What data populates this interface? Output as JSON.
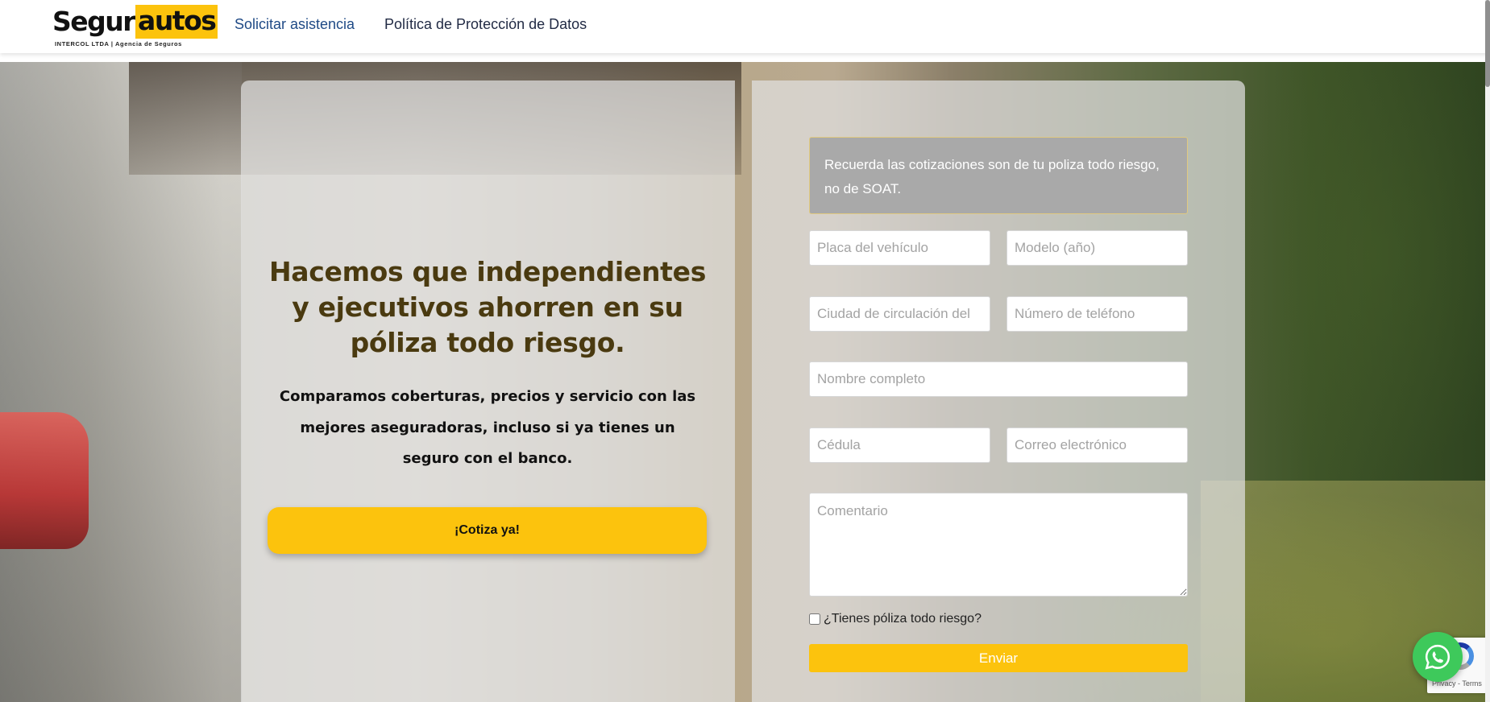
{
  "header": {
    "logo": {
      "part1": "Segur",
      "part2": "autos",
      "tagline": "INTERCOL LTDA | Agencia de Seguros"
    },
    "nav": [
      {
        "label": "Solicitar asistencia"
      },
      {
        "label": "Política de Protección de Datos"
      }
    ]
  },
  "hero": {
    "title": "Hacemos que independientes y ejecutivos ahorren en su póliza todo riesgo.",
    "subtitle": "Comparamos coberturas, precios y servicio con las mejores aseguradoras, incluso si ya tienes un seguro con el banco.",
    "cta_label": "¡Cotiza ya!"
  },
  "form": {
    "notice": "Recuerda las cotizaciones son de tu poliza todo riesgo, no de SOAT.",
    "fields": {
      "placa": {
        "placeholder": "Placa del vehículo",
        "value": ""
      },
      "modelo": {
        "placeholder": "Modelo (año)",
        "value": ""
      },
      "ciudad": {
        "placeholder": "Ciudad de circulación del",
        "value": ""
      },
      "telefono": {
        "placeholder": "Número de teléfono",
        "value": ""
      },
      "nombre": {
        "placeholder": "Nombre completo",
        "value": ""
      },
      "cedula": {
        "placeholder": "Cédula",
        "value": ""
      },
      "correo": {
        "placeholder": "Correo electrónico",
        "value": ""
      },
      "comentario": {
        "placeholder": "Comentario",
        "value": ""
      }
    },
    "checkbox_label": "¿Tienes póliza todo riesgo?",
    "checkbox_checked": false,
    "submit_label": "Enviar"
  },
  "recaptcha": {
    "links": "Privacy - Terms"
  },
  "icons": {
    "whatsapp": "whatsapp-icon",
    "recaptcha": "recaptcha-icon"
  },
  "colors": {
    "accent": "#fcc30d",
    "nav_link": "#1f4a86",
    "title": "#4a3a10",
    "notice_bg": "#a9a9a9",
    "whatsapp": "#3ec95b"
  }
}
